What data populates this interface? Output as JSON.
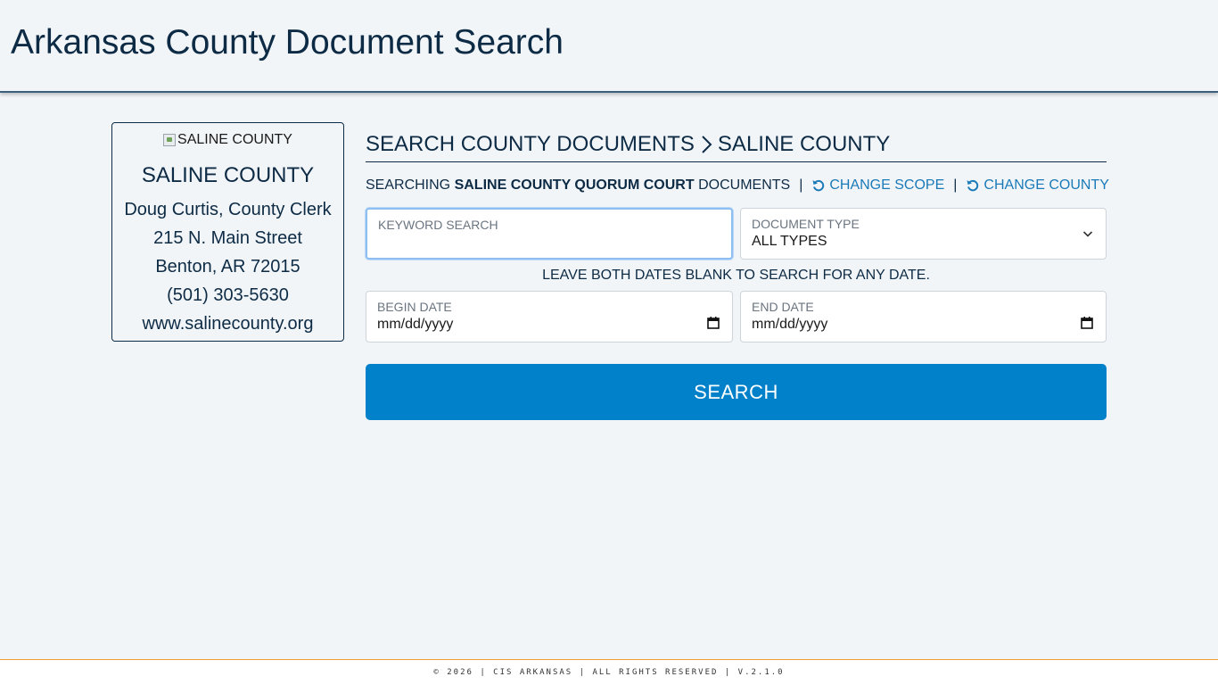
{
  "header": {
    "title": "Arkansas County Document Search"
  },
  "county_card": {
    "image_alt": "SALINE COUNTY",
    "name": "SALINE COUNTY",
    "clerk": "Doug Curtis, County Clerk",
    "address": "215 N. Main Street",
    "city": "Benton, AR 72015",
    "phone": "(501) 303-5630",
    "website": "www.salinecounty.org"
  },
  "breadcrumb": {
    "root": "SEARCH COUNTY DOCUMENTS",
    "current": "SALINE COUNTY"
  },
  "scope": {
    "prefix": "SEARCHING",
    "scope_name": "SALINE COUNTY QUORUM COURT",
    "suffix": "DOCUMENTS",
    "pipe": "|",
    "change_scope": "CHANGE SCOPE",
    "change_county": "CHANGE COUNTY"
  },
  "form": {
    "keyword_label": "KEYWORD SEARCH",
    "keyword_value": "",
    "doctype_label": "DOCUMENT TYPE",
    "doctype_value": "ALL TYPES",
    "date_hint": "LEAVE BOTH DATES BLANK TO SEARCH FOR ANY DATE.",
    "begin_label": "BEGIN DATE",
    "begin_value": "mm/dd/yyyy",
    "end_label": "END DATE",
    "end_value": "mm/dd/yyyy",
    "search_label": "SEARCH"
  },
  "footer": {
    "text": "© 2026 | CIS ARKANSAS | ALL RIGHTS RESERVED | V.2.1.0"
  },
  "colors": {
    "accent": "#0081c9",
    "link": "#1a7ab8",
    "text": "#0d2b45",
    "footer_border": "#f0a030"
  }
}
